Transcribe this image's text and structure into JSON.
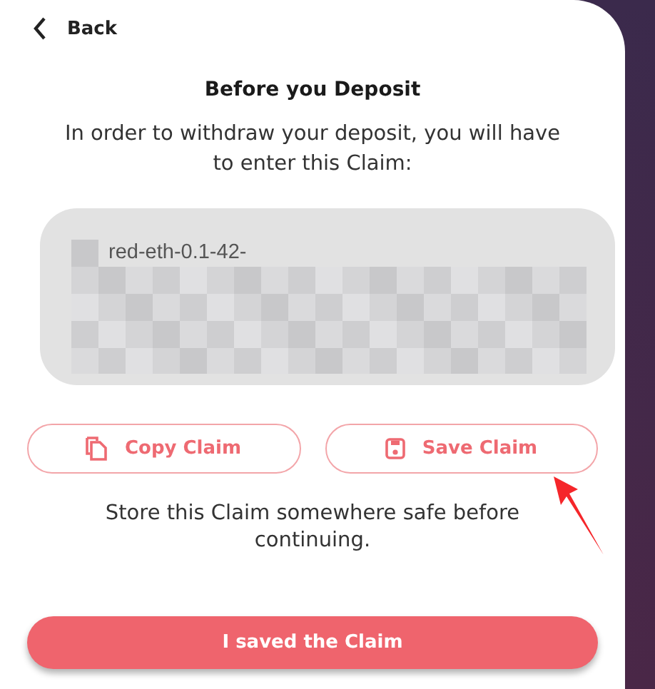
{
  "header": {
    "back_label": "Back"
  },
  "title": "Before you Deposit",
  "intro": "In order to withdraw your deposit, you will have to enter this Claim:",
  "claim": {
    "visible_text": "red-eth-0.1-42-",
    "redacted": true
  },
  "actions": [
    {
      "kind": "copy",
      "label": "Copy Claim"
    },
    {
      "kind": "save",
      "label": "Save Claim"
    }
  ],
  "note": "Store this Claim somewhere safe before continuing.",
  "confirm_button": "I saved the Claim",
  "annotation": {
    "kind": "arrow"
  }
}
